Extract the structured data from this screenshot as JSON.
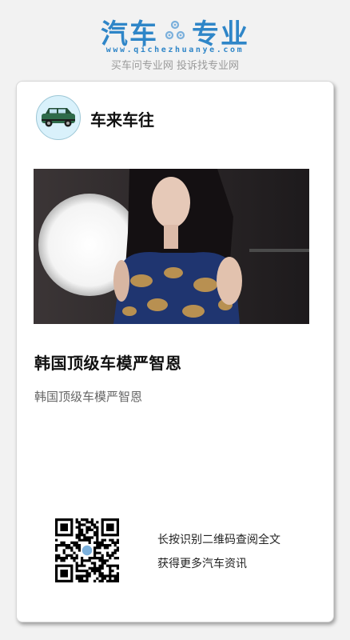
{
  "logo": {
    "left_text": "汽车",
    "right_text": "专业",
    "url": "www.qichezhuanye.com",
    "slogan": "买车问专业网 投诉找专业网",
    "brand_color": "#2f86c8"
  },
  "post": {
    "author": "车来车往",
    "title": "韩国顶级车模严智恩",
    "description": "韩国顶级车模严智恩"
  },
  "qr": {
    "line1": "长按识别二维码查阅全文",
    "line2": "获得更多汽车资讯"
  }
}
